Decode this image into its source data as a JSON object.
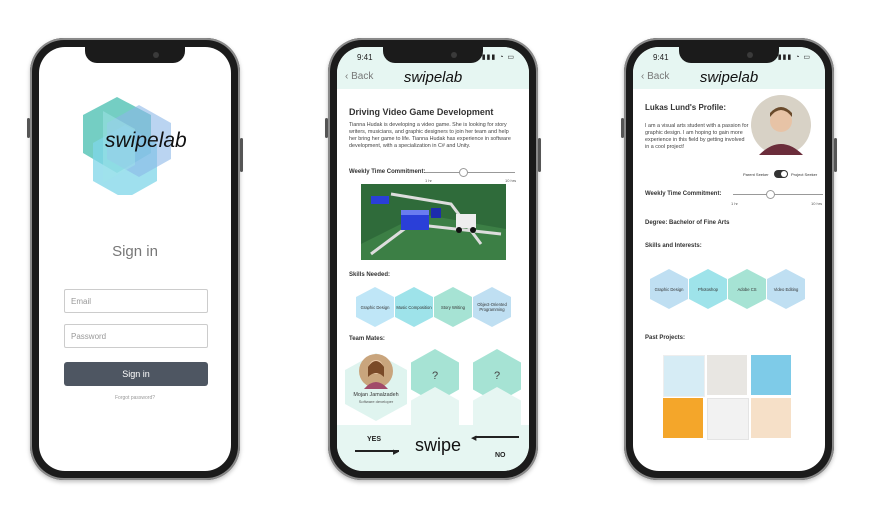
{
  "screen1": {
    "logo": "swipelab",
    "title": "Sign in",
    "email_placeholder": "Email",
    "password_placeholder": "Password",
    "signin_label": "Sign in",
    "forgot_label": "Forgot password?"
  },
  "screen2": {
    "time": "9:41",
    "back": "Back",
    "logo": "swipelab",
    "title": "Driving Video Game Development",
    "description": "Tianna Hudak is developing a  video game. She is looking for story writers, musicians, and graphic designers to join her team and help her bring her game to life.  Tianna Hudak has experience in software development, with a specialization in C# and Unity.",
    "weekly_label": "Weekly Time Commitment:",
    "min_tick": "1 hr",
    "max_tick": "10 hrs",
    "skills_label": "Skills Needed:",
    "skills": [
      "Graphic Design",
      "Music Composition",
      "Story Writing",
      "Object-Oriented Programming"
    ],
    "team_label": "Team Mates:",
    "mate_name": "Mojan Jamalzadeh",
    "mate_role": "Software developer",
    "unknown1": "?",
    "unknown2": "?",
    "yes": "YES",
    "no": "NO",
    "swipe": "swipe"
  },
  "screen3": {
    "time": "9:41",
    "back": "Back",
    "logo": "swipelab",
    "title": "Lukas Lund's Profile:",
    "bio": "I am a visual arts student with a passion for graphic design. I am hoping to gain more experience in this field by getting involved in a cool project!",
    "toggle_left": "Parent Seeker",
    "toggle_right": "Project Seeker",
    "weekly_label": "Weekly Time Commitment:",
    "min_tick": "1 hr",
    "max_tick": "10 hrs",
    "degree": "Degree: Bachelor of Fine Arts",
    "skills_label": "Skills and Interests:",
    "skills": [
      "Graphic Design",
      "Photoshop",
      "Adobe CS",
      "Video Editing"
    ],
    "projects_label": "Past Projects:"
  }
}
